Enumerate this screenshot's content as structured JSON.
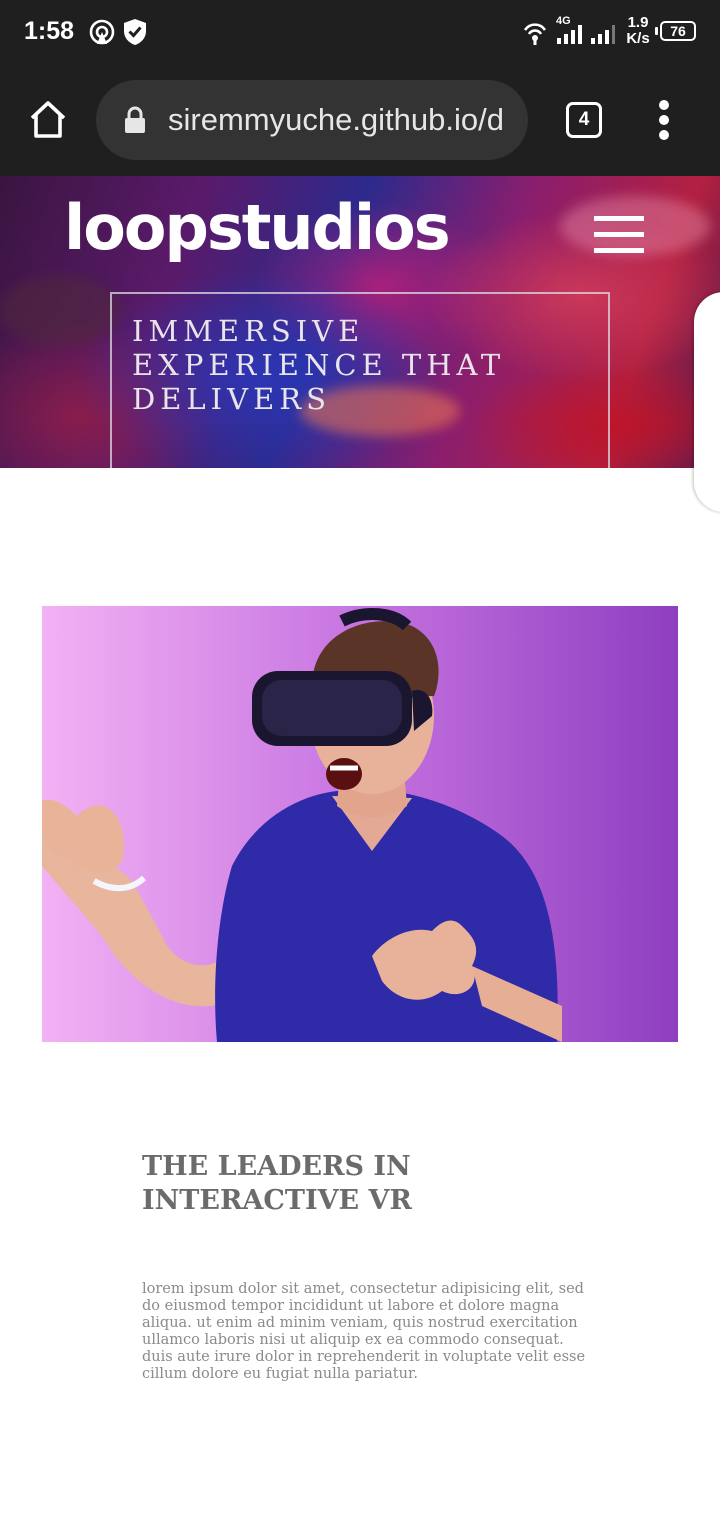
{
  "status_bar": {
    "time": "1:58",
    "network_label": "4G",
    "net_speed": "1.9\nK/s",
    "battery": "76",
    "icons": [
      "hotspot-icon",
      "shield-icon",
      "wifi-icon",
      "signal-icon",
      "signal-icon"
    ]
  },
  "browser": {
    "url": "siremmyuche.github.io/d",
    "tab_count": "4",
    "icons": [
      "home-icon",
      "lock-icon",
      "overflow-menu-icon"
    ]
  },
  "hero": {
    "logo": "loopstudios",
    "title": "IMMERSIVE EXPERIENCE THAT DELIVERS",
    "menu_icon": "hamburger-icon"
  },
  "main": {
    "image": "vr-headset-man-photo",
    "heading": "THE LEADERS IN INTERACTIVE VR",
    "body": "lorem ipsum dolor sit amet, consectetur adipisicing elit, sed do eiusmod tempor incididunt ut labore et dolore magna aliqua. ut enim ad minim veniam, quis nostrud exercitation ullamco laboris nisi ut aliquip ex ea commodo consequat. duis aute irure dolor in reprehenderit in voluptate velit esse cillum dolore eu fugiat nulla pariatur."
  },
  "colors": {
    "chrome": "#1f1f1f",
    "url_bar": "#333333",
    "heading": "#6b6b6b",
    "body_text": "#8a8a8a",
    "image_bg": "#c37ae0",
    "shirt": "#2e2aa8"
  }
}
